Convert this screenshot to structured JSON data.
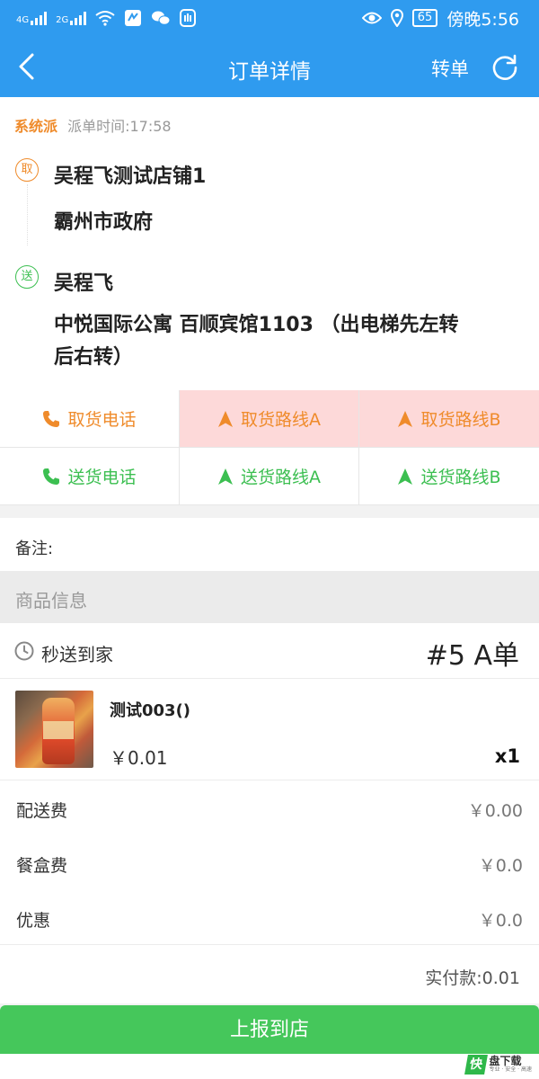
{
  "status_bar": {
    "signal1": "4G",
    "signal2": "2G",
    "battery": "65",
    "time": "傍晚5:56"
  },
  "header": {
    "title": "订单详情",
    "transfer_label": "转单"
  },
  "order": {
    "dispatch_source": "系统派",
    "dispatch_time": "派单时间:17:58",
    "pickup_tag": "取",
    "pickup_store": "吴程飞测试店铺1",
    "pickup_address": "霸州市政府",
    "delivery_tag": "送",
    "receiver_name": "吴程飞",
    "receiver_address": "中悦国际公寓 百顺宾馆1103 （出电梯先左转后右转）"
  },
  "actions": {
    "pickup_phone": "取货电话",
    "pickup_route_a": "取货路线A",
    "pickup_route_b": "取货路线B",
    "delivery_phone": "送货电话",
    "delivery_route_a": "送货路线A",
    "delivery_route_b": "送货路线B"
  },
  "remark_label": "备注:",
  "goods_section_title": "商品信息",
  "delivery_type": "秒送到家",
  "order_number": "#5 A单",
  "product": {
    "name": "测试003()",
    "price": "￥0.01",
    "quantity": "x1"
  },
  "fees": [
    {
      "label": "配送费",
      "value": "￥0.00"
    },
    {
      "label": "餐盒费",
      "value": "￥0.0"
    },
    {
      "label": "优惠",
      "value": "￥0.0"
    }
  ],
  "total": "实付款:0.01",
  "report_button": "上报到店",
  "watermark": {
    "mark": "快",
    "title": "盘下载",
    "sub": "专业 · 安全 · 高速"
  },
  "colors": {
    "header_blue": "#2f9bef",
    "orange": "#ef8b2b",
    "green": "#3cbf51",
    "button_green": "#45c75b",
    "highlight_pink": "#fdd9d9"
  }
}
